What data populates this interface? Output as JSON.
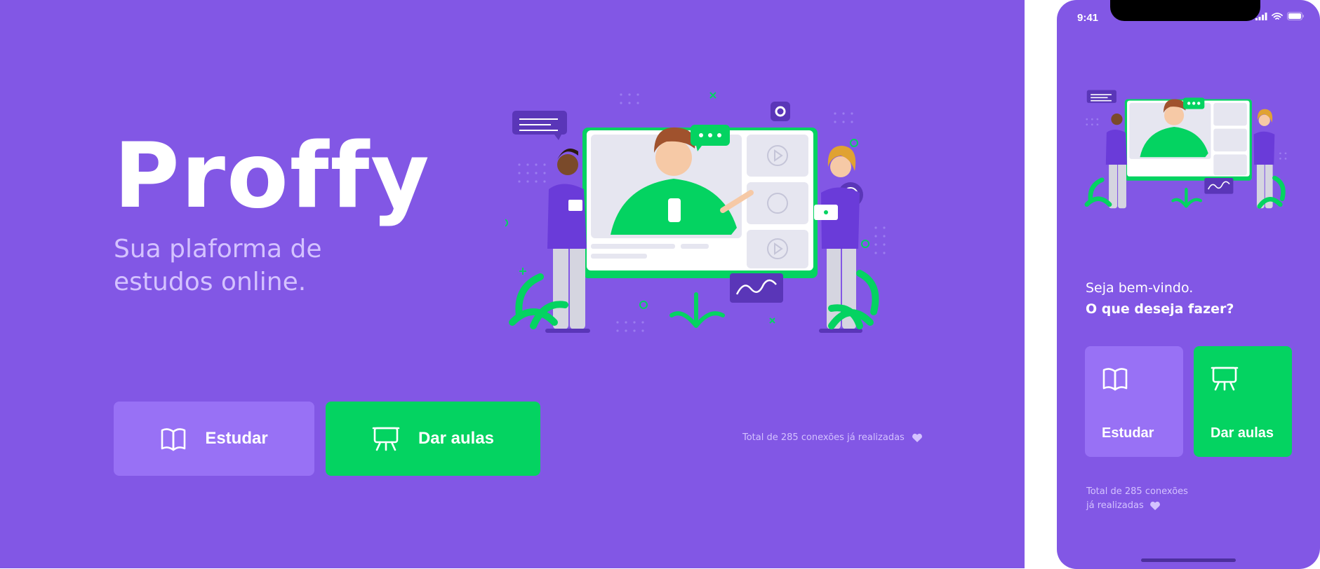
{
  "desktop": {
    "logo": "Proffy",
    "tagline": "Sua plaforma de estudos online.",
    "buttons": {
      "study": "Estudar",
      "teach": "Dar aulas"
    },
    "connections": "Total de 285 conexões já realizadas"
  },
  "mobile": {
    "status_time": "9:41",
    "welcome": "Seja bem-vindo.",
    "question": "O que deseja fazer?",
    "buttons": {
      "study": "Estudar",
      "teach": "Dar aulas"
    },
    "connections_line1": "Total de 285 conexões",
    "connections_line2": "já realizadas"
  },
  "colors": {
    "primary": "#8257e5",
    "primary_light": "#9871f5",
    "secondary": "#04d361",
    "text_light": "#d4c2ff"
  },
  "icons": [
    "book-icon",
    "presentation-board-icon",
    "heart-icon",
    "signal-icon",
    "wifi-icon",
    "battery-icon"
  ]
}
